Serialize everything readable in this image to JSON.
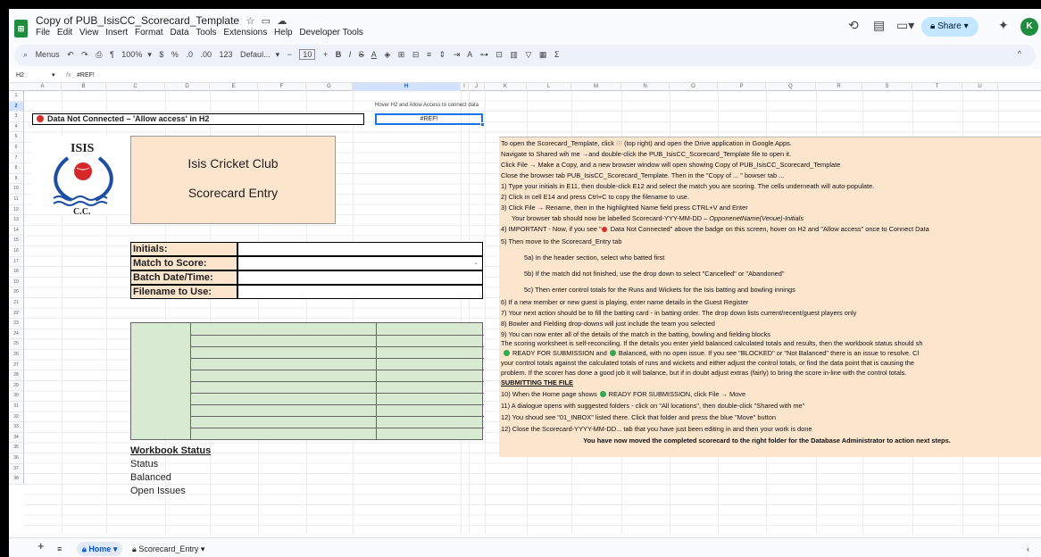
{
  "doc": {
    "title": "Copy of PUB_IsisCC_Scorecard_Template",
    "menus": [
      "File",
      "Edit",
      "View",
      "Insert",
      "Format",
      "Data",
      "Tools",
      "Extensions",
      "Help",
      "Developer Tools"
    ],
    "share_label": "Share",
    "avatar_letter": "K"
  },
  "toolbar": {
    "menus_label": "Menus",
    "zoom": "100%",
    "currency": "$",
    "percent": "%",
    "dec_less": ".0",
    "dec_more": ".00",
    "num_format": "123",
    "font": "Defaul...",
    "font_size": "10",
    "bold": "B",
    "italic": "I",
    "strike": "S",
    "underline_a": "A",
    "sigma": "Σ"
  },
  "formula": {
    "cell_ref": "H2",
    "fx": "fx",
    "value": "#REF!"
  },
  "columns": [
    "A",
    "B",
    "C",
    "D",
    "E",
    "F",
    "G",
    "H",
    "I",
    "J",
    "K",
    "L",
    "M",
    "N",
    "O",
    "P",
    "Q",
    "R",
    "S",
    "T",
    "U"
  ],
  "rows": [
    "1",
    "2",
    "3",
    "4",
    "5",
    "6",
    "7",
    "8",
    "9",
    "10",
    "11",
    "12",
    "13",
    "14",
    "15",
    "16",
    "17",
    "18",
    "19",
    "20",
    "21",
    "22",
    "23",
    "24",
    "25",
    "26",
    "27",
    "28",
    "29",
    "30",
    "31",
    "32",
    "33",
    "34",
    "35",
    "36",
    "37",
    "38"
  ],
  "sheet": {
    "banner": "Data Not Connected – 'Allow access' in H2",
    "h1_note": "Hover H2 and Allow Access to connect data",
    "h2_value": "#REF!",
    "logo_text": "ISIS",
    "logo_sub": "C.C.",
    "club_name": "Isis Cricket Club",
    "club_sub": "Scorecard Entry",
    "labels": [
      "Initials:",
      "Match to Score:",
      "Batch Date/Time:",
      "Filename to Use:"
    ],
    "workbook_status_title": "Workbook Status",
    "status_items": [
      "Status",
      "Balanced",
      "Open Issues"
    ]
  },
  "instructions": {
    "l1a": "To open the Scorecard_Template, click",
    "l1b": "(top right) and open the Drive application in Google Apps.",
    "l2": "Navigate to Shared wih me →and double-click the PUB_IsisCC_Scorecard_Template file to open it.",
    "l3": "Click File → Make a Copy, and a new browser window will open showing Copy of PUB_IsisCC_Scorecard_Template",
    "l4": "Close the browser tab PUB_IsisCC_Scorecard_Template.  Then in the \"Copy of ... \" bowser tab ...",
    "l5": "1) Type your initials in E11, then double-click E12 and select the match you are scoring.  The cells underneath will auto-populate.",
    "l6": "2) Click in cell E14 and press Ctrl+C to copy the filename to use.",
    "l7": "3) Click File → Rename, then in the highlighted Name field press CTRL+V and Enter",
    "l8a": "Your browser tab should now be labelled Scorecard-YYY-MM-DD –",
    "l8b": "OpponenetName(Venue)-Initials",
    "l9a": "4) IMPORTANT - Now, if you see \"",
    "l9b": "Data Not Connected\" above the badge on this screen, hover on H2 and \"Allow access\" once to Connect Data",
    "l10": "5) Then move to the Scorecard_Entry tab",
    "l11": "5a) In the header section, select who batted first",
    "l12": "5b) If the match did not finished, use the drop down to select \"Cancelled\" or \"Abandoned\"",
    "l13": "5c) Then enter control totals for the Runs and Wickets for the Isis batting and bowling innings",
    "l14": "6) If a new member or new guest is playing, enter name details in the Guest Register",
    "l15": "7) Your next action should be to fill the batting card - in batting order.  The drop down lists current/recent/guest players only",
    "l16": "8) Bowler and Fielding drop-downs will just include the team you selected",
    "l17": "9) You can now enter all of the details of the match in the batting, bowling and fielding blocks",
    "l18": "The scoring worksheet is self-reconciling.  If the details you enter yield balanced calculated totals and results, then the workbook status should sh",
    "l19a": "READY FOR SUBMISSION and",
    "l19b": "Balanced, with no open issue.  If you see \"BLOCKED\" or \"Not Balanced\" there is an issue to resolve.  Cl",
    "l20": "your control totals against the calculated totals of runs and wickets and either adjust the control totals, or find the data point that is causing the",
    "l21": "problem.  If the scorer has done a good job it will balance, but if in doubt adjust extras (fairly) to bring the score in-line with the control totals.",
    "l22": "SUBMITTING THE FILE",
    "l23a": "10) When the Home page shows",
    "l23b": "READY FOR SUBMISSION, click File → Move",
    "l24": "11) A dialogue opens with suggested folders - click on \"All locations\", then double-click \"Shared with me\"",
    "l25": "12) You shoud see \"01_INBOX\" listed there.  Click that folder and press the blue \"Move\" button",
    "l26": "12) Close the Scorecard-YYYY-MM-DD... tab that you have just been editing in and then your work is done",
    "l27": "You have now moved the completed scorecard to the right folder for the Database Administrator to action next steps."
  },
  "tabs": {
    "home": "Home",
    "entry": "Scorecard_Entry"
  },
  "colors": {
    "peach": "#fce5cd",
    "green_area": "#d9ead3",
    "selection": "#1a73e8"
  }
}
